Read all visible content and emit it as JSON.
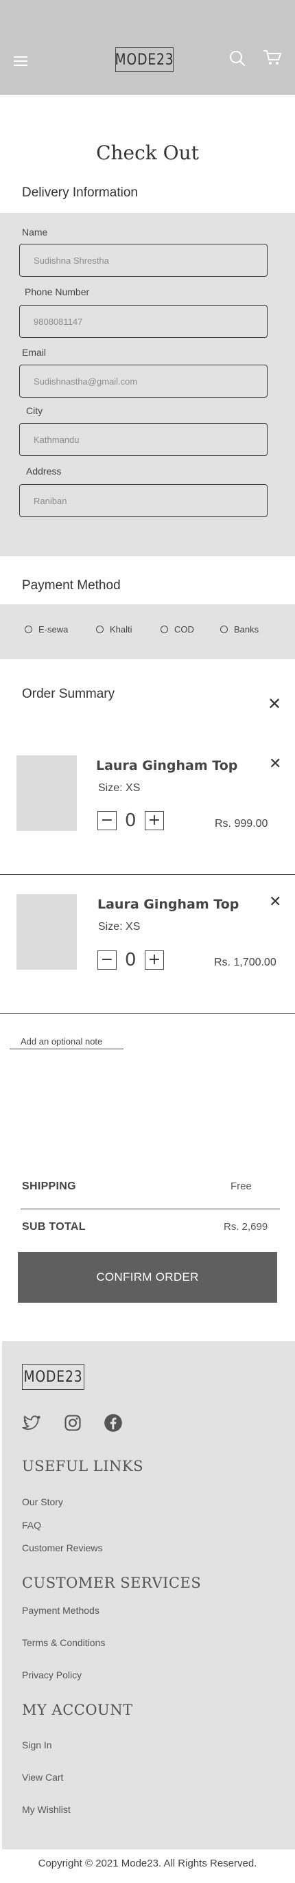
{
  "header": {
    "logo": "MODE23",
    "colors": {
      "background": "#c8c8c8"
    }
  },
  "page_title": "Check Out",
  "delivery": {
    "title": "Delivery Information",
    "fields": [
      {
        "label": "Name",
        "placeholder": "Sudishna Shrestha"
      },
      {
        "label": "Phone Number",
        "placeholder": "9808081147"
      },
      {
        "label": "Email",
        "placeholder": "Sudishnastha@gmail.com"
      },
      {
        "label": "City",
        "placeholder": "Kathmandu"
      },
      {
        "label": "Address",
        "placeholder": "Raniban"
      }
    ]
  },
  "payment": {
    "title": "Payment Method",
    "options": [
      "E-sewa",
      "Khalti",
      "COD",
      "Banks"
    ]
  },
  "order_summary": {
    "title": "Order Summary",
    "items": [
      {
        "name": "Laura Gingham Top",
        "size": "Size: XS",
        "qty": "0",
        "price": "Rs. 999.00"
      },
      {
        "name": "Laura Gingham Top",
        "size": "Size: XS",
        "qty": "0",
        "price": "Rs. 1,700.00"
      }
    ],
    "note_link": "Add an optional note",
    "shipping_label": "SHIPPING",
    "shipping_value": "Free",
    "subtotal_label": "SUB TOTAL",
    "subtotal_value": "Rs. 2,699",
    "confirm_label": "CONFIRM ORDER"
  },
  "footer": {
    "logo": "MODE23",
    "social_icons": [
      "twitter-icon",
      "instagram-icon",
      "facebook-icon"
    ],
    "useful_links_title": "USEFUL LINKS",
    "useful_links": [
      "Our Story",
      "FAQ",
      "Customer Reviews"
    ],
    "customer_services_title": "CUSTOMER SERVICES",
    "customer_services": [
      "Payment Methods",
      "Terms & Conditions",
      "Privacy Policy"
    ],
    "my_account_title": "MY ACCOUNT",
    "my_account": [
      "Sign In",
      "View Cart",
      "My Wishlist"
    ],
    "copyright": "Copyright © 2021 Mode23. All Rights Reserved."
  },
  "colors": {
    "panel": "#e2e2e2",
    "button": "#5f5f5f",
    "text": "#3a3a3a"
  }
}
